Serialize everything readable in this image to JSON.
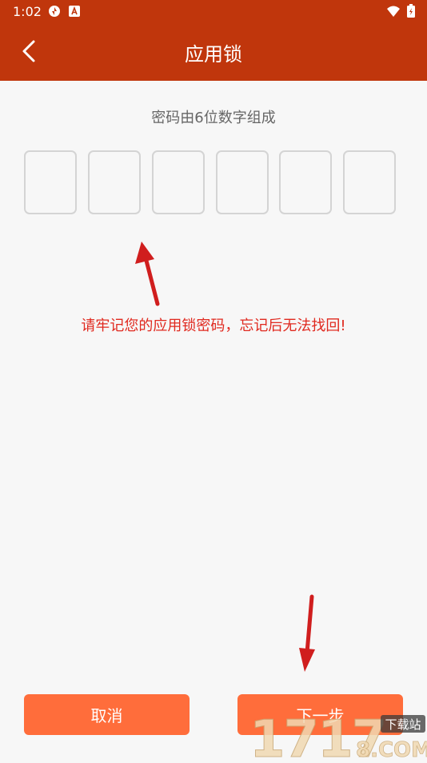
{
  "status_bar": {
    "time": "1:02",
    "icons": [
      "sync-icon",
      "a-notification-icon",
      "wifi-icon",
      "battery-charging-icon"
    ]
  },
  "header": {
    "title": "应用锁",
    "back_icon": "chevron-left-icon",
    "background_color": "#c0360c"
  },
  "main": {
    "subtitle": "密码由6位数字组成",
    "pin_digits": [
      "",
      "",
      "",
      "",
      "",
      ""
    ],
    "warning": "请牢记您的应用锁密码，忘记后无法找回!",
    "warning_color": "#e0291f"
  },
  "footer": {
    "cancel_label": "取消",
    "next_label": "下一步",
    "button_color": "#ff6d3b"
  },
  "watermark": {
    "text": "17178.COM",
    "tag": "下载站"
  }
}
